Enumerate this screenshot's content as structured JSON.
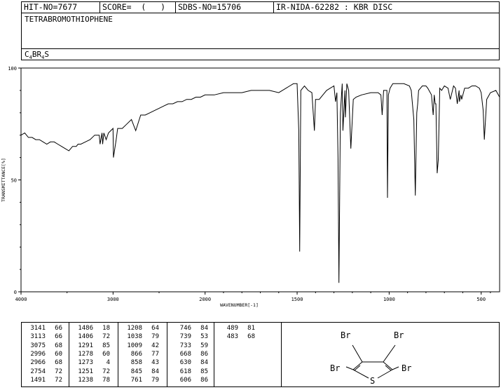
{
  "header": {
    "hit": "HIT-NO=7677",
    "score": "SCORE=  (   )",
    "sdbs": "SDBS-NO=15706",
    "ir": "IR-NIDA-62282 : KBR DISC"
  },
  "compound": {
    "name": "TETRABROMOTHIOPHENE",
    "formula_parts": [
      [
        "C",
        ""
      ],
      [
        "4",
        "sub"
      ],
      [
        "BR",
        ""
      ],
      [
        "4",
        "sub"
      ],
      [
        "S",
        ""
      ]
    ]
  },
  "structure": {
    "atoms": [
      "Br",
      "Br",
      "Br",
      "Br",
      "S"
    ]
  },
  "chart_data": {
    "type": "line",
    "title": "",
    "xlabel": "WAVENUMBER[-1]",
    "ylabel": "TRANSMITTANCE[%]",
    "xlim": [
      4000,
      400
    ],
    "ylim": [
      0,
      100
    ],
    "x_ticks": [
      "4000",
      "3000",
      "2000",
      "1500",
      "1000",
      "500"
    ],
    "y_ticks": [
      "100",
      "50",
      "0"
    ],
    "grid": false,
    "series": [
      {
        "x": [
          4000,
          3960,
          3920,
          3880,
          3840,
          3800,
          3760,
          3720,
          3680,
          3640,
          3600,
          3560,
          3520,
          3480,
          3440,
          3400,
          3380,
          3350,
          3300,
          3250,
          3200,
          3150,
          3141,
          3120,
          3113,
          3100,
          3075,
          3050,
          3000,
          2996,
          2966,
          2950,
          2900,
          2850,
          2800,
          2754,
          2700,
          2650,
          2600,
          2550,
          2500,
          2450,
          2400,
          2350,
          2300,
          2250,
          2200,
          2150,
          2100,
          2050,
          2000,
          1950,
          1900,
          1850,
          1800,
          1750,
          1700,
          1650,
          1600,
          1560,
          1540,
          1520,
          1500,
          1491,
          1486,
          1480,
          1460,
          1440,
          1420,
          1406,
          1400,
          1380,
          1360,
          1340,
          1320,
          1300,
          1291,
          1284,
          1278,
          1273,
          1265,
          1255,
          1251,
          1240,
          1238,
          1230,
          1220,
          1208,
          1195,
          1180,
          1150,
          1100,
          1060,
          1045,
          1038,
          1030,
          1020,
          1012,
          1009,
          1004,
          995,
          980,
          950,
          920,
          890,
          880,
          866,
          858,
          850,
          845,
          840,
          820,
          800,
          790,
          770,
          761,
          755,
          750,
          746,
          739,
          733,
          725,
          715,
          700,
          680,
          668,
          650,
          640,
          630,
          620,
          618,
          610,
          606,
          590,
          570,
          550,
          530,
          510,
          500,
          489,
          483,
          470,
          450,
          420,
          400
        ],
        "y": [
          70,
          71,
          69,
          69,
          68,
          68,
          67,
          66,
          67,
          67,
          66,
          65,
          64,
          63,
          65,
          65,
          66,
          66,
          67,
          68,
          70,
          70,
          66,
          71,
          66,
          71,
          68,
          71,
          73,
          60,
          68,
          73,
          73,
          75,
          77,
          72,
          79,
          79,
          80,
          81,
          82,
          83,
          84,
          84,
          85,
          85,
          86,
          86,
          87,
          87,
          88,
          88,
          89,
          89,
          89,
          90,
          90,
          90,
          89,
          91,
          92,
          93,
          93,
          72,
          18,
          90,
          92,
          90,
          89,
          72,
          86,
          86,
          88,
          90,
          91,
          92,
          85,
          89,
          60,
          4,
          80,
          93,
          72,
          90,
          78,
          93,
          90,
          64,
          86,
          87,
          88,
          89,
          89,
          88,
          79,
          90,
          90,
          90,
          42,
          88,
          91,
          93,
          93,
          93,
          92,
          90,
          77,
          43,
          80,
          84,
          90,
          92,
          92,
          91,
          88,
          79,
          88,
          84,
          84,
          53,
          59,
          91,
          90,
          92,
          91,
          86,
          92,
          91,
          84,
          90,
          85,
          88,
          86,
          91,
          91,
          92,
          92,
          91,
          89,
          81,
          68,
          86,
          89,
          90,
          87
        ]
      }
    ]
  },
  "peak_table": {
    "columns": [
      [
        [
          "3141",
          "66"
        ],
        [
          "3113",
          "66"
        ],
        [
          "3075",
          "68"
        ],
        [
          "2996",
          "60"
        ],
        [
          "2966",
          "68"
        ],
        [
          "2754",
          "72"
        ],
        [
          "1491",
          "72"
        ]
      ],
      [
        [
          "1486",
          "18"
        ],
        [
          "1406",
          "72"
        ],
        [
          "1291",
          "85"
        ],
        [
          "1278",
          "60"
        ],
        [
          "1273",
          "4"
        ],
        [
          "1251",
          "72"
        ],
        [
          "1238",
          "78"
        ]
      ],
      [
        [
          "1208",
          "64"
        ],
        [
          "1038",
          "79"
        ],
        [
          "1009",
          "42"
        ],
        [
          "866",
          "77"
        ],
        [
          "858",
          "43"
        ],
        [
          "845",
          "84"
        ],
        [
          "761",
          "79"
        ]
      ],
      [
        [
          "746",
          "84"
        ],
        [
          "739",
          "53"
        ],
        [
          "733",
          "59"
        ],
        [
          "668",
          "86"
        ],
        [
          "630",
          "84"
        ],
        [
          "618",
          "85"
        ],
        [
          "606",
          "86"
        ]
      ],
      [
        [
          "489",
          "81"
        ],
        [
          "483",
          "68"
        ]
      ]
    ]
  }
}
